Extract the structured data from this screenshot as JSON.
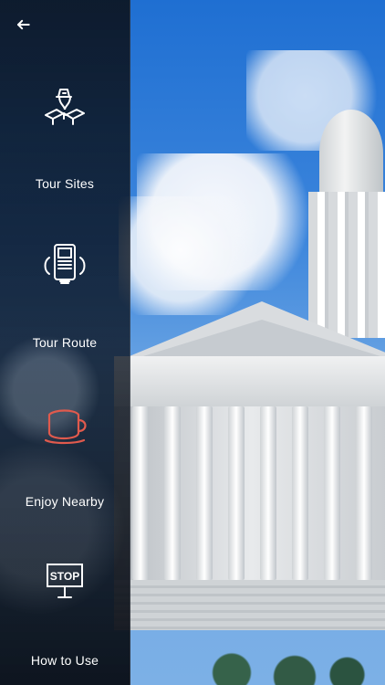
{
  "menu": {
    "items": [
      {
        "label": "Tour Sites"
      },
      {
        "label": "Tour Route"
      },
      {
        "label": "Enjoy Nearby"
      },
      {
        "label": "How to Use"
      }
    ]
  },
  "icons": {
    "stop_sign_text": "STOP"
  },
  "colors": {
    "sidebar_text": "#ffffff",
    "accent_red": "#e05a4d"
  }
}
